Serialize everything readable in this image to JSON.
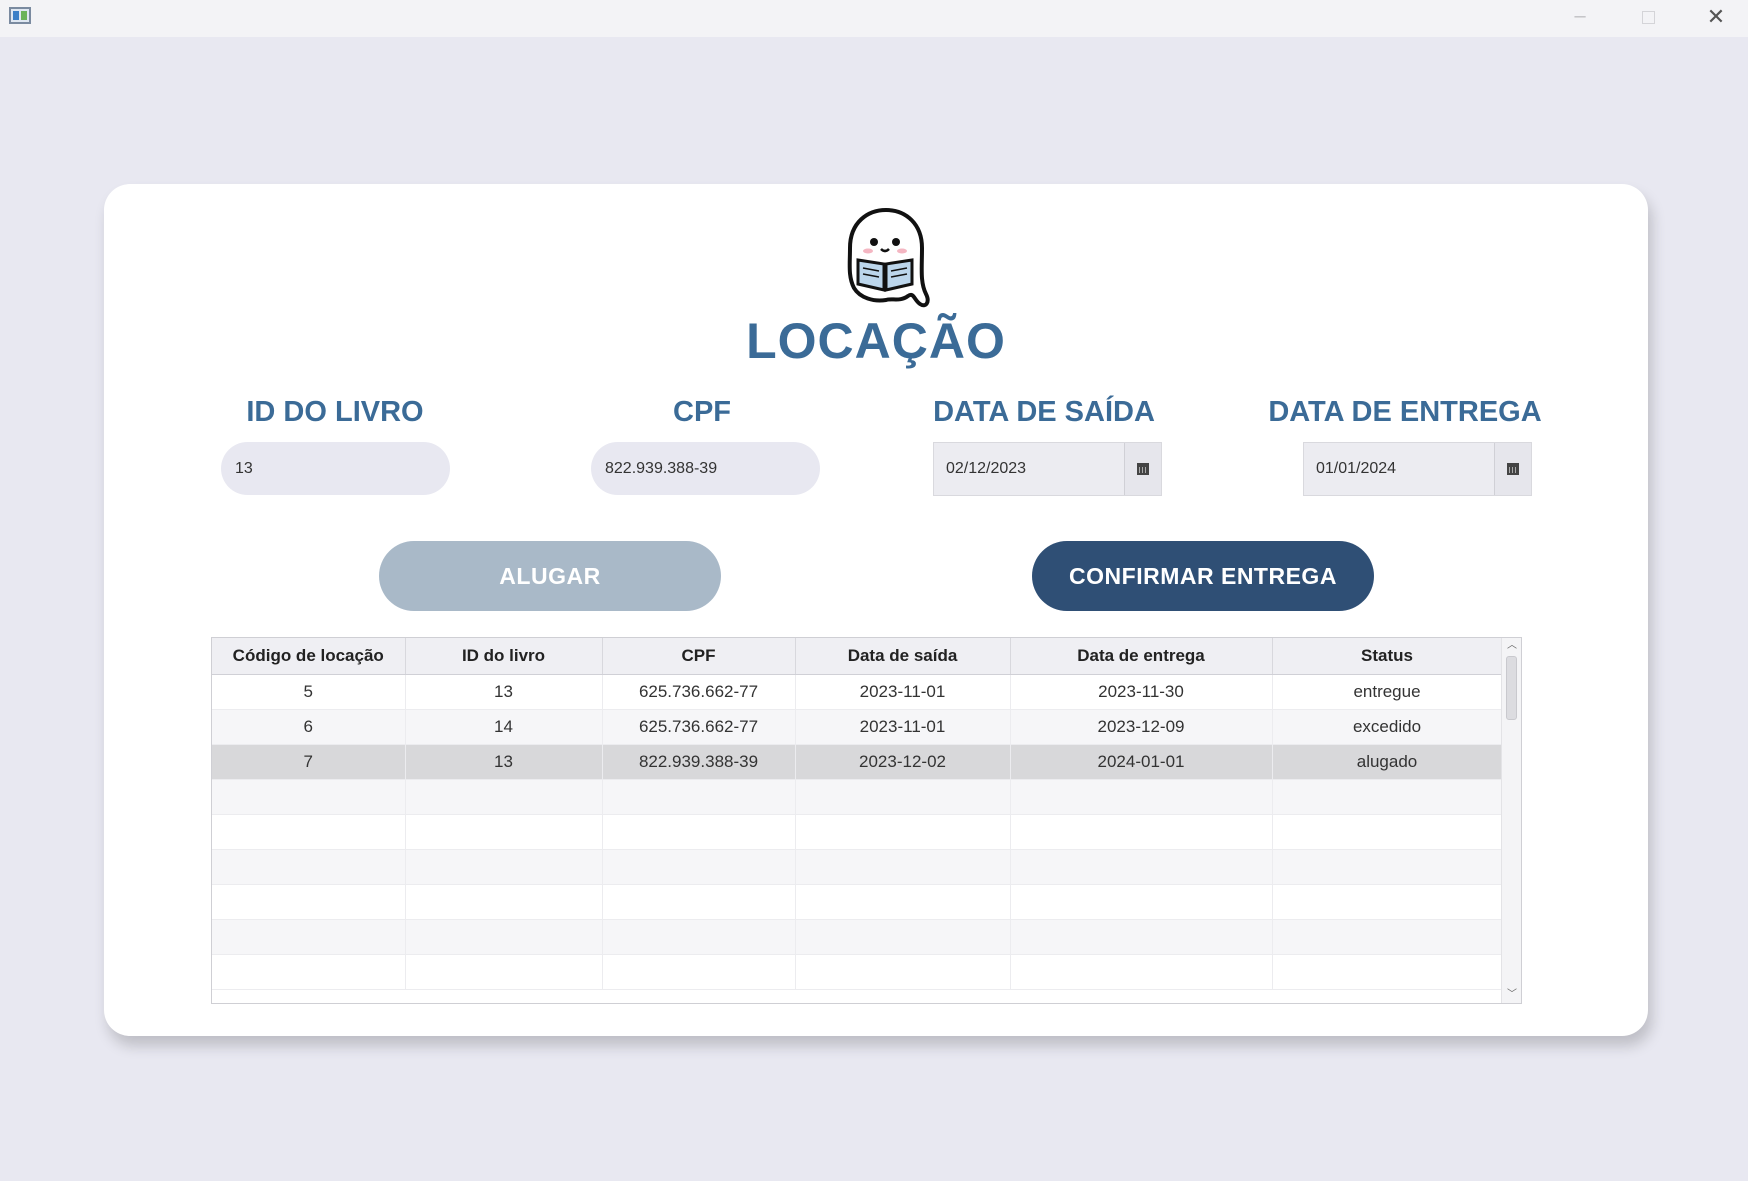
{
  "window": {
    "min_glyph": "─",
    "close_glyph": "✕"
  },
  "page": {
    "title": "LOCAÇÃO"
  },
  "fields": {
    "id_label": "ID DO LIVRO",
    "id_value": "13",
    "cpf_label": "CPF",
    "cpf_value": "822.939.388-39",
    "saida_label": "DATA DE SAÍDA",
    "saida_value": "02/12/2023",
    "entrega_label": "DATA DE ENTREGA",
    "entrega_value": "01/01/2024"
  },
  "buttons": {
    "alugar": "ALUGAR",
    "confirmar": "CONFIRMAR ENTREGA"
  },
  "table": {
    "columns": [
      "Código de locação",
      "ID do livro",
      "CPF",
      "Data de saída",
      "Data de entrega",
      "Status"
    ],
    "rows": [
      [
        "5",
        "13",
        "625.736.662-77",
        "2023-11-01",
        "2023-11-30",
        "entregue"
      ],
      [
        "6",
        "14",
        "625.736.662-77",
        "2023-11-01",
        "2023-12-09",
        "excedido"
      ],
      [
        "7",
        "13",
        "822.939.388-39",
        "2023-12-02",
        "2024-01-01",
        "alugado"
      ]
    ],
    "selected_row": 2
  },
  "scroll": {
    "up_glyph": "︿",
    "down_glyph": "﹀"
  },
  "colors": {
    "accent": "#3b6b97",
    "primary_button": "#2f4f75",
    "disabled_button": "#a9b9c8",
    "background": "#e8e8f1"
  }
}
